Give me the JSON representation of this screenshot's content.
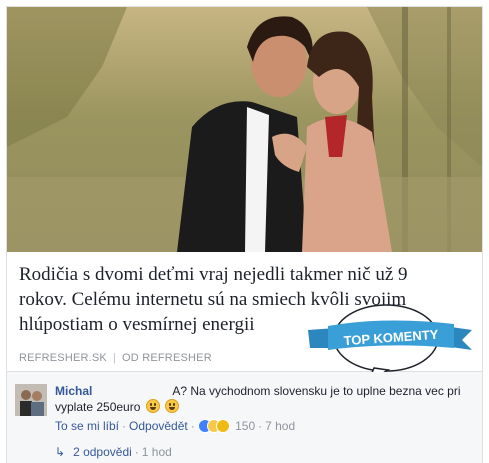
{
  "post": {
    "headline": "Rodičia s dvomi deťmi vraj nejedli takmer nič už 9 rokov. Celému internetu sú na smiech kvôli svojim hlúpostiam o vesmírnej energii",
    "source_site": "REFRESHER.SK",
    "source_separator": "|",
    "source_author": "OD REFRESHER"
  },
  "badge": {
    "label": "TOP KOMENTY",
    "color": "#3a9fd6"
  },
  "comment": {
    "author": "Michal",
    "text": "A? Na vychodnom slovensku je to uplne bezna vec pri vyplate 250euro",
    "like_label": "To se mi líbí",
    "reply_label": "Odpovědět",
    "reaction_count": "150",
    "time": "7 hod",
    "replies_label": "2 odpovědi",
    "replies_time": "1 hod"
  },
  "colors": {
    "link": "#365899",
    "meta": "#90949c",
    "comment_bg": "#f6f7f9"
  }
}
